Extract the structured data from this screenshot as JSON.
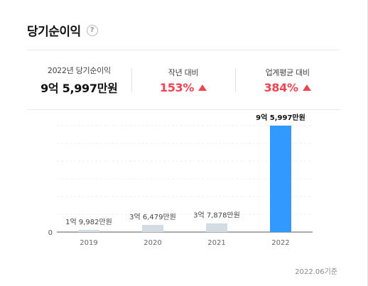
{
  "header": {
    "title": "당기순이익",
    "help_label": "?"
  },
  "stats": [
    {
      "label": "2022년 당기순이익",
      "value": "9억 5,997만원",
      "trend": "neutral"
    },
    {
      "label": "작년 대비",
      "value": "153%",
      "trend": "up"
    },
    {
      "label": "업계평균 대비",
      "value": "384%",
      "trend": "up"
    }
  ],
  "chart_data": {
    "type": "bar",
    "categories": [
      "2019",
      "2020",
      "2021",
      "2022"
    ],
    "values": [
      19982,
      64790,
      78780,
      959970
    ],
    "value_unit": "만원",
    "data_labels": [
      "1억 9,982만원",
      "3억 6,479만원",
      "3억 7,878만원",
      "9억 5,997만원"
    ],
    "y_tick_labels": [
      "0"
    ],
    "highlight_index": 3,
    "colors": {
      "default": "#d3dce3",
      "highlight": "#3299ff"
    }
  },
  "footnote": "2022.06기준"
}
